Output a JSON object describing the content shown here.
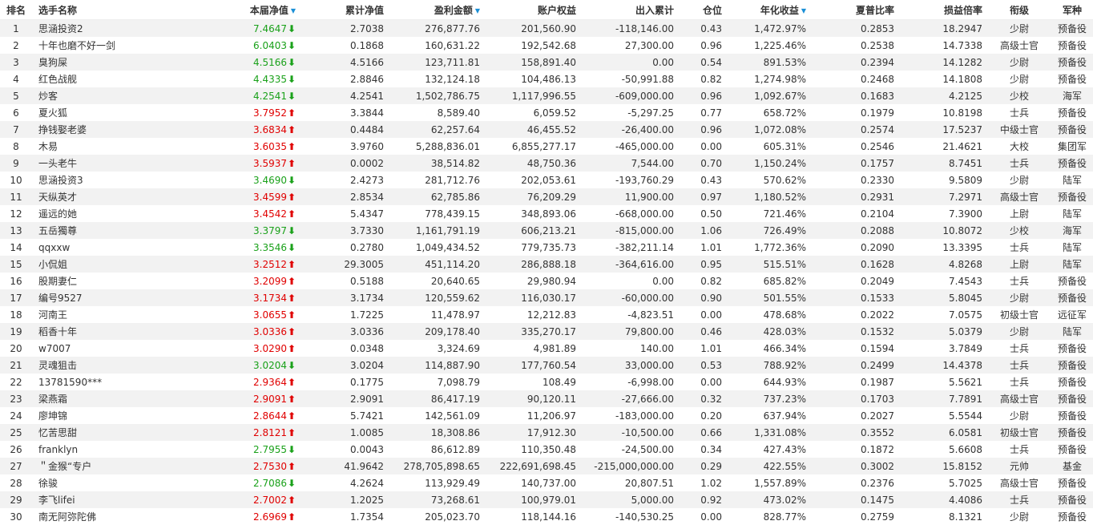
{
  "colors": {
    "up": "#e00000",
    "down": "#1aa11a",
    "sort_indicator": "#1a8fd6",
    "stripe": "#f2f2f2"
  },
  "headers": {
    "rank": "排名",
    "name": "选手名称",
    "weekly_nav": "本届净值",
    "cum_nav": "累计净值",
    "profit": "盈利金额",
    "equity": "账户权益",
    "inout": "出入累计",
    "position": "仓位",
    "annual": "年化收益",
    "sharpe": "夏普比率",
    "pl_ratio": "损益倍率",
    "title": "衔级",
    "branch": "军种"
  },
  "sort_icons": {
    "weekly_nav": "caret-down-icon",
    "profit": "caret-down-icon",
    "annual": "caret-down-icon"
  },
  "rows": [
    {
      "rank": "1",
      "name": "思涵投资2",
      "nav": "7.4647",
      "trend": "down",
      "cum_nav": "2.7038",
      "profit": "276,877.76",
      "equity": "201,560.90",
      "inout": "-118,146.00",
      "position": "0.43",
      "annual": "1,472.97%",
      "sharpe": "0.2853",
      "pl_ratio": "18.2947",
      "title": "少尉",
      "branch": "预备役"
    },
    {
      "rank": "2",
      "name": "十年也磨不好一剑",
      "nav": "6.0403",
      "trend": "down",
      "cum_nav": "0.1868",
      "profit": "160,631.22",
      "equity": "192,542.68",
      "inout": "27,300.00",
      "position": "0.96",
      "annual": "1,225.46%",
      "sharpe": "0.2538",
      "pl_ratio": "14.7338",
      "title": "高级士官",
      "branch": "预备役"
    },
    {
      "rank": "3",
      "name": "臭狗屎",
      "nav": "4.5166",
      "trend": "down",
      "cum_nav": "4.5166",
      "profit": "123,711.81",
      "equity": "158,891.40",
      "inout": "0.00",
      "position": "0.54",
      "annual": "891.53%",
      "sharpe": "0.2394",
      "pl_ratio": "14.1282",
      "title": "少尉",
      "branch": "预备役"
    },
    {
      "rank": "4",
      "name": "红色战舰",
      "nav": "4.4335",
      "trend": "down",
      "cum_nav": "2.8846",
      "profit": "132,124.18",
      "equity": "104,486.13",
      "inout": "-50,991.88",
      "position": "0.82",
      "annual": "1,274.98%",
      "sharpe": "0.2468",
      "pl_ratio": "14.1808",
      "title": "少尉",
      "branch": "预备役"
    },
    {
      "rank": "5",
      "name": "炒客",
      "nav": "4.2541",
      "trend": "down",
      "cum_nav": "4.2541",
      "profit": "1,502,786.75",
      "equity": "1,117,996.55",
      "inout": "-609,000.00",
      "position": "0.96",
      "annual": "1,092.67%",
      "sharpe": "0.1683",
      "pl_ratio": "4.2125",
      "title": "少校",
      "branch": "海军"
    },
    {
      "rank": "6",
      "name": "夏火狐",
      "nav": "3.7952",
      "trend": "up",
      "cum_nav": "3.3844",
      "profit": "8,589.40",
      "equity": "6,059.52",
      "inout": "-5,297.25",
      "position": "0.77",
      "annual": "658.72%",
      "sharpe": "0.1979",
      "pl_ratio": "10.8198",
      "title": "士兵",
      "branch": "预备役"
    },
    {
      "rank": "7",
      "name": "挣钱娶老婆",
      "nav": "3.6834",
      "trend": "up",
      "cum_nav": "0.4484",
      "profit": "62,257.64",
      "equity": "46,455.52",
      "inout": "-26,400.00",
      "position": "0.96",
      "annual": "1,072.08%",
      "sharpe": "0.2574",
      "pl_ratio": "17.5237",
      "title": "中级士官",
      "branch": "预备役"
    },
    {
      "rank": "8",
      "name": "木易",
      "nav": "3.6035",
      "trend": "up",
      "cum_nav": "3.9760",
      "profit": "5,288,836.01",
      "equity": "6,855,277.17",
      "inout": "-465,000.00",
      "position": "0.00",
      "annual": "605.31%",
      "sharpe": "0.2546",
      "pl_ratio": "21.4621",
      "title": "大校",
      "branch": "集团军"
    },
    {
      "rank": "9",
      "name": "一头老牛",
      "nav": "3.5937",
      "trend": "up",
      "cum_nav": "0.0002",
      "profit": "38,514.82",
      "equity": "48,750.36",
      "inout": "7,544.00",
      "position": "0.70",
      "annual": "1,150.24%",
      "sharpe": "0.1757",
      "pl_ratio": "8.7451",
      "title": "士兵",
      "branch": "预备役"
    },
    {
      "rank": "10",
      "name": "思涵投资3",
      "nav": "3.4690",
      "trend": "down",
      "cum_nav": "2.4273",
      "profit": "281,712.76",
      "equity": "202,053.61",
      "inout": "-193,760.29",
      "position": "0.43",
      "annual": "570.62%",
      "sharpe": "0.2330",
      "pl_ratio": "9.5809",
      "title": "少尉",
      "branch": "陆军"
    },
    {
      "rank": "11",
      "name": "天纵英才",
      "nav": "3.4599",
      "trend": "up",
      "cum_nav": "2.8534",
      "profit": "62,785.86",
      "equity": "76,209.29",
      "inout": "11,900.00",
      "position": "0.97",
      "annual": "1,180.52%",
      "sharpe": "0.2931",
      "pl_ratio": "7.2971",
      "title": "高级士官",
      "branch": "预备役"
    },
    {
      "rank": "12",
      "name": "遥远的她",
      "nav": "3.4542",
      "trend": "up",
      "cum_nav": "5.4347",
      "profit": "778,439.15",
      "equity": "348,893.06",
      "inout": "-668,000.00",
      "position": "0.50",
      "annual": "721.46%",
      "sharpe": "0.2104",
      "pl_ratio": "7.3900",
      "title": "上尉",
      "branch": "陆军"
    },
    {
      "rank": "13",
      "name": "五岳獨尊",
      "nav": "3.3797",
      "trend": "down",
      "cum_nav": "3.7330",
      "profit": "1,161,791.19",
      "equity": "606,213.21",
      "inout": "-815,000.00",
      "position": "1.06",
      "annual": "726.49%",
      "sharpe": "0.2088",
      "pl_ratio": "10.8072",
      "title": "少校",
      "branch": "海军"
    },
    {
      "rank": "14",
      "name": "qqxxw",
      "nav": "3.3546",
      "trend": "down",
      "cum_nav": "0.2780",
      "profit": "1,049,434.52",
      "equity": "779,735.73",
      "inout": "-382,211.14",
      "position": "1.01",
      "annual": "1,772.36%",
      "sharpe": "0.2090",
      "pl_ratio": "13.3395",
      "title": "士兵",
      "branch": "陆军"
    },
    {
      "rank": "15",
      "name": "小侃姐",
      "nav": "3.2512",
      "trend": "up",
      "cum_nav": "29.3005",
      "profit": "451,114.20",
      "equity": "286,888.18",
      "inout": "-364,616.00",
      "position": "0.95",
      "annual": "515.51%",
      "sharpe": "0.1628",
      "pl_ratio": "4.8268",
      "title": "上尉",
      "branch": "陆军"
    },
    {
      "rank": "16",
      "name": "股期妻仁",
      "nav": "3.2099",
      "trend": "up",
      "cum_nav": "0.5188",
      "profit": "20,640.65",
      "equity": "29,980.94",
      "inout": "0.00",
      "position": "0.82",
      "annual": "685.82%",
      "sharpe": "0.2049",
      "pl_ratio": "7.4543",
      "title": "士兵",
      "branch": "预备役"
    },
    {
      "rank": "17",
      "name": "编号9527",
      "nav": "3.1734",
      "trend": "up",
      "cum_nav": "3.1734",
      "profit": "120,559.62",
      "equity": "116,030.17",
      "inout": "-60,000.00",
      "position": "0.90",
      "annual": "501.55%",
      "sharpe": "0.1533",
      "pl_ratio": "5.8045",
      "title": "少尉",
      "branch": "预备役"
    },
    {
      "rank": "18",
      "name": "河南王",
      "nav": "3.0655",
      "trend": "up",
      "cum_nav": "1.7225",
      "profit": "11,478.97",
      "equity": "12,212.83",
      "inout": "-4,823.51",
      "position": "0.00",
      "annual": "478.68%",
      "sharpe": "0.2022",
      "pl_ratio": "7.0575",
      "title": "初级士官",
      "branch": "远征军"
    },
    {
      "rank": "19",
      "name": "稻香十年",
      "nav": "3.0336",
      "trend": "up",
      "cum_nav": "3.0336",
      "profit": "209,178.40",
      "equity": "335,270.17",
      "inout": "79,800.00",
      "position": "0.46",
      "annual": "428.03%",
      "sharpe": "0.1532",
      "pl_ratio": "5.0379",
      "title": "少尉",
      "branch": "陆军"
    },
    {
      "rank": "20",
      "name": "w7007",
      "nav": "3.0290",
      "trend": "up",
      "cum_nav": "0.0348",
      "profit": "3,324.69",
      "equity": "4,981.89",
      "inout": "140.00",
      "position": "1.01",
      "annual": "466.34%",
      "sharpe": "0.1594",
      "pl_ratio": "3.7849",
      "title": "士兵",
      "branch": "预备役"
    },
    {
      "rank": "21",
      "name": "灵魂狙击",
      "nav": "3.0204",
      "trend": "down",
      "cum_nav": "3.0204",
      "profit": "114,887.90",
      "equity": "177,760.54",
      "inout": "33,000.00",
      "position": "0.53",
      "annual": "788.92%",
      "sharpe": "0.2499",
      "pl_ratio": "14.4378",
      "title": "士兵",
      "branch": "预备役"
    },
    {
      "rank": "22",
      "name": "13781590***",
      "nav": "2.9364",
      "trend": "up",
      "cum_nav": "0.1775",
      "profit": "7,098.79",
      "equity": "108.49",
      "inout": "-6,998.00",
      "position": "0.00",
      "annual": "644.93%",
      "sharpe": "0.1987",
      "pl_ratio": "5.5621",
      "title": "士兵",
      "branch": "预备役"
    },
    {
      "rank": "23",
      "name": "梁燕霜",
      "nav": "2.9091",
      "trend": "up",
      "cum_nav": "2.9091",
      "profit": "86,417.19",
      "equity": "90,120.11",
      "inout": "-27,666.00",
      "position": "0.32",
      "annual": "737.23%",
      "sharpe": "0.1703",
      "pl_ratio": "7.7891",
      "title": "高级士官",
      "branch": "预备役"
    },
    {
      "rank": "24",
      "name": "廖坤锦",
      "nav": "2.8644",
      "trend": "up",
      "cum_nav": "5.7421",
      "profit": "142,561.09",
      "equity": "11,206.97",
      "inout": "-183,000.00",
      "position": "0.20",
      "annual": "637.94%",
      "sharpe": "0.2027",
      "pl_ratio": "5.5544",
      "title": "少尉",
      "branch": "预备役"
    },
    {
      "rank": "25",
      "name": "忆苦思甜",
      "nav": "2.8121",
      "trend": "up",
      "cum_nav": "1.0085",
      "profit": "18,308.86",
      "equity": "17,912.30",
      "inout": "-10,500.00",
      "position": "0.66",
      "annual": "1,331.08%",
      "sharpe": "0.3552",
      "pl_ratio": "6.0581",
      "title": "初级士官",
      "branch": "预备役"
    },
    {
      "rank": "26",
      "name": "franklyn",
      "nav": "2.7955",
      "trend": "down",
      "cum_nav": "0.0043",
      "profit": "86,612.89",
      "equity": "110,350.48",
      "inout": "-24,500.00",
      "position": "0.34",
      "annual": "427.43%",
      "sharpe": "0.1872",
      "pl_ratio": "5.6608",
      "title": "士兵",
      "branch": "预备役"
    },
    {
      "rank": "27",
      "name": "＂金猴“专户",
      "nav": "2.7530",
      "trend": "up",
      "cum_nav": "41.9642",
      "profit": "278,705,898.65",
      "equity": "222,691,698.45",
      "inout": "-215,000,000.00",
      "position": "0.29",
      "annual": "422.55%",
      "sharpe": "0.3002",
      "pl_ratio": "15.8152",
      "title": "元帅",
      "branch": "基金"
    },
    {
      "rank": "28",
      "name": "徐骏",
      "nav": "2.7086",
      "trend": "down",
      "cum_nav": "4.2624",
      "profit": "113,929.49",
      "equity": "140,737.00",
      "inout": "20,807.51",
      "position": "1.02",
      "annual": "1,557.89%",
      "sharpe": "0.2376",
      "pl_ratio": "5.7025",
      "title": "高级士官",
      "branch": "预备役"
    },
    {
      "rank": "29",
      "name": "李飞lifei",
      "nav": "2.7002",
      "trend": "up",
      "cum_nav": "1.2025",
      "profit": "73,268.61",
      "equity": "100,979.01",
      "inout": "5,000.00",
      "position": "0.92",
      "annual": "473.02%",
      "sharpe": "0.1475",
      "pl_ratio": "4.4086",
      "title": "士兵",
      "branch": "预备役"
    },
    {
      "rank": "30",
      "name": "南无阿弥陀佛",
      "nav": "2.6969",
      "trend": "up",
      "cum_nav": "1.7354",
      "profit": "205,023.70",
      "equity": "118,144.16",
      "inout": "-140,530.25",
      "position": "0.00",
      "annual": "828.77%",
      "sharpe": "0.2759",
      "pl_ratio": "8.1321",
      "title": "少尉",
      "branch": "预备役"
    }
  ]
}
